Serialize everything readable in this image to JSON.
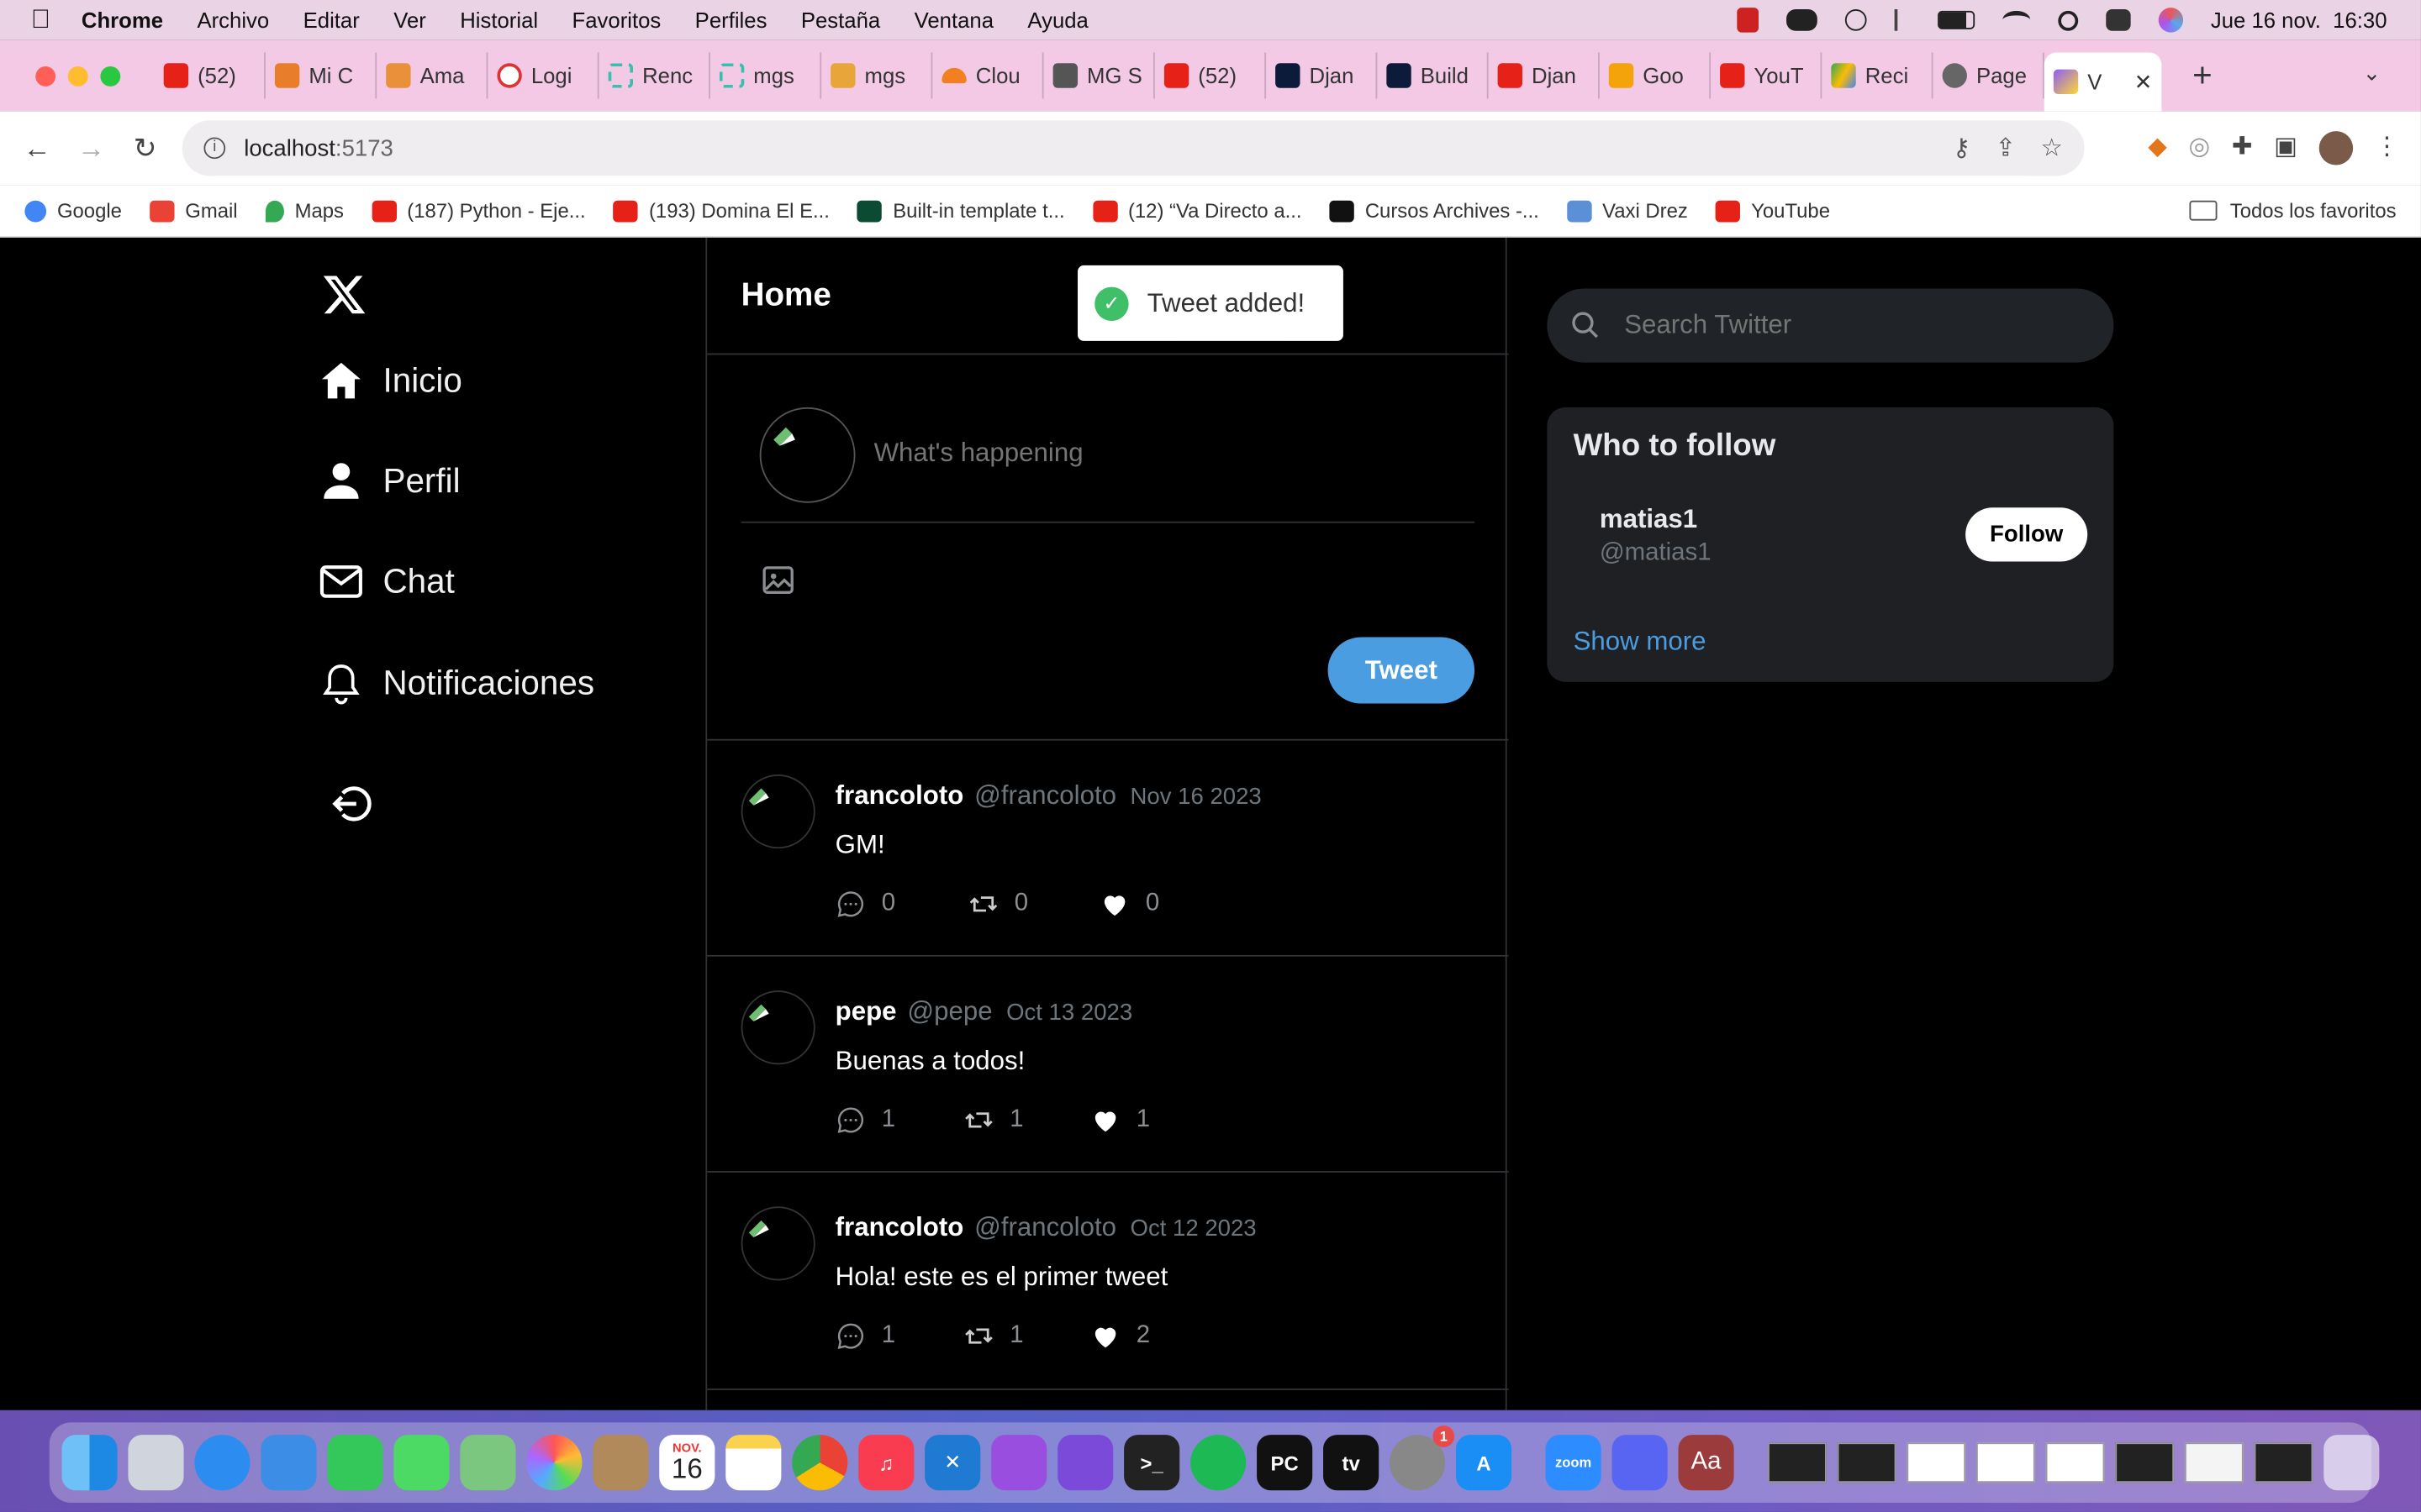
{
  "menubar": {
    "app": "Chrome",
    "items": [
      "Archivo",
      "Editar",
      "Ver",
      "Historial",
      "Favoritos",
      "Perfiles",
      "Pestaña",
      "Ventana",
      "Ayuda"
    ],
    "datetime": "Jue 16 nov.  16:30"
  },
  "tabs": [
    {
      "label": "(52)",
      "color": "#e62117"
    },
    {
      "label": "Mi C",
      "color": "#e87d2a"
    },
    {
      "label": "Ama",
      "color": "#e8903a"
    },
    {
      "label": "Logi",
      "color": "#d33"
    },
    {
      "label": "Renc",
      "color": "#3bbfad"
    },
    {
      "label": "mgs",
      "color": "#3bbfad"
    },
    {
      "label": "mgs",
      "color": "#e8a53a"
    },
    {
      "label": "Clou",
      "color": "#f38020"
    },
    {
      "label": "MG S",
      "color": "#555"
    },
    {
      "label": "(52)",
      "color": "#e62117"
    },
    {
      "label": "Djan",
      "color": "#0c1b3a"
    },
    {
      "label": "Build",
      "color": "#0c1b3a"
    },
    {
      "label": "Djan",
      "color": "#e62117"
    },
    {
      "label": "Goo",
      "color": "#f4a30a"
    },
    {
      "label": "YouT",
      "color": "#e62117"
    },
    {
      "label": "Reci",
      "color": "#34a853"
    },
    {
      "label": "Page",
      "color": "#666"
    },
    {
      "label": "V",
      "color": "#8f5cf7"
    }
  ],
  "toolbar": {
    "url_host": "localhost",
    "url_port": ":5173"
  },
  "bookmarks": [
    {
      "label": "Google",
      "color": "#4285f4"
    },
    {
      "label": "Gmail",
      "color": "#ea4335"
    },
    {
      "label": "Maps",
      "color": "#34a853"
    },
    {
      "label": "(187) Python - Eje...",
      "color": "#e62117"
    },
    {
      "label": "(193) Domina El E...",
      "color": "#e62117"
    },
    {
      "label": "Built-in template t...",
      "color": "#0c4b33"
    },
    {
      "label": "(12) “Va Directo a...",
      "color": "#e62117"
    },
    {
      "label": "Cursos Archives -...",
      "color": "#111"
    },
    {
      "label": "Vaxi Drez",
      "color": "#5b8fd6"
    },
    {
      "label": "YouTube",
      "color": "#e62117"
    }
  ],
  "bookmarks_all": "Todos los favoritos",
  "app": {
    "nav": {
      "home": "Inicio",
      "profile": "Perfil",
      "chat": "Chat",
      "notifications": "Notificaciones"
    },
    "main_title": "Home",
    "compose_placeholder": "What's happening",
    "tweet_button": "Tweet",
    "toast": "Tweet added!",
    "tweets": [
      {
        "name": "francoloto",
        "handle": "@francoloto",
        "date": "Nov 16 2023",
        "text": "GM!",
        "replies": "0",
        "retweets": "0",
        "likes": "0"
      },
      {
        "name": "pepe",
        "handle": "@pepe",
        "date": "Oct 13 2023",
        "text": "Buenas a todos!",
        "replies": "1",
        "retweets": "1",
        "likes": "1"
      },
      {
        "name": "francoloto",
        "handle": "@francoloto",
        "date": "Oct 12 2023",
        "text": "Hola! este es el primer tweet",
        "replies": "1",
        "retweets": "1",
        "likes": "2"
      }
    ],
    "search_placeholder": "Search Twitter",
    "who_to_follow": {
      "title": "Who to follow",
      "name": "matias1",
      "handle": "@matias1",
      "follow_button": "Follow",
      "show_more": "Show more"
    }
  },
  "dock": {
    "calendar_month": "NOV.",
    "calendar_day": "16",
    "settings_badge": "1",
    "zoom_label": "zoom",
    "pycharm_label": "PC",
    "dictionary_label": "Aa",
    "tv_label": "tv"
  }
}
